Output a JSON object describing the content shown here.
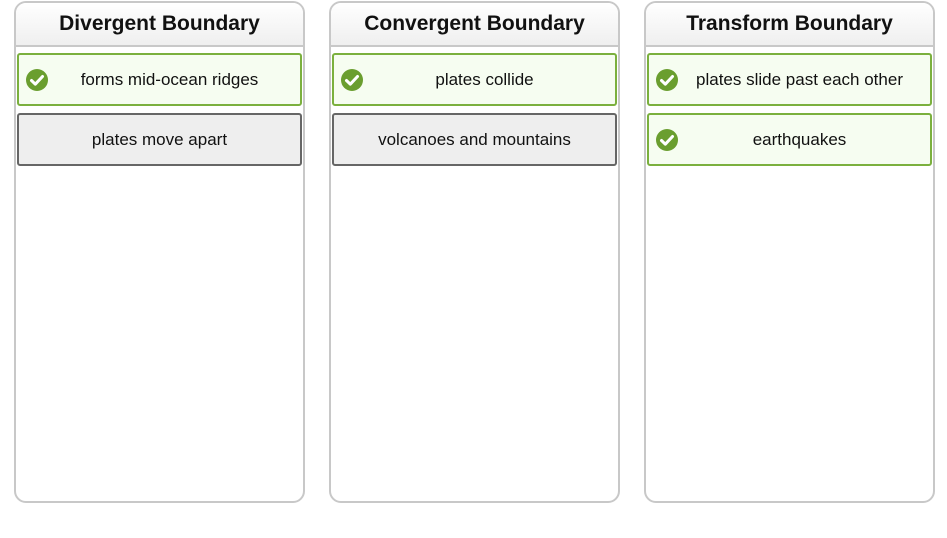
{
  "columns": [
    {
      "title": "Divergent Boundary",
      "items": [
        {
          "label": "forms mid-ocean ridges",
          "status": "correct"
        },
        {
          "label": "plates move apart",
          "status": "neutral"
        }
      ]
    },
    {
      "title": "Convergent Boundary",
      "items": [
        {
          "label": "plates collide",
          "status": "correct"
        },
        {
          "label": "volcanoes and mountains",
          "status": "neutral"
        }
      ]
    },
    {
      "title": "Transform Boundary",
      "items": [
        {
          "label": "plates slide past each other",
          "status": "correct"
        },
        {
          "label": "earthquakes",
          "status": "correct"
        }
      ]
    }
  ],
  "colors": {
    "correct_border": "#7bb03e",
    "correct_icon": "#6a9e2f",
    "neutral_border": "#666666",
    "neutral_fill": "#eeeeee"
  },
  "icons": {
    "correct": "checkmark-circle-icon"
  }
}
